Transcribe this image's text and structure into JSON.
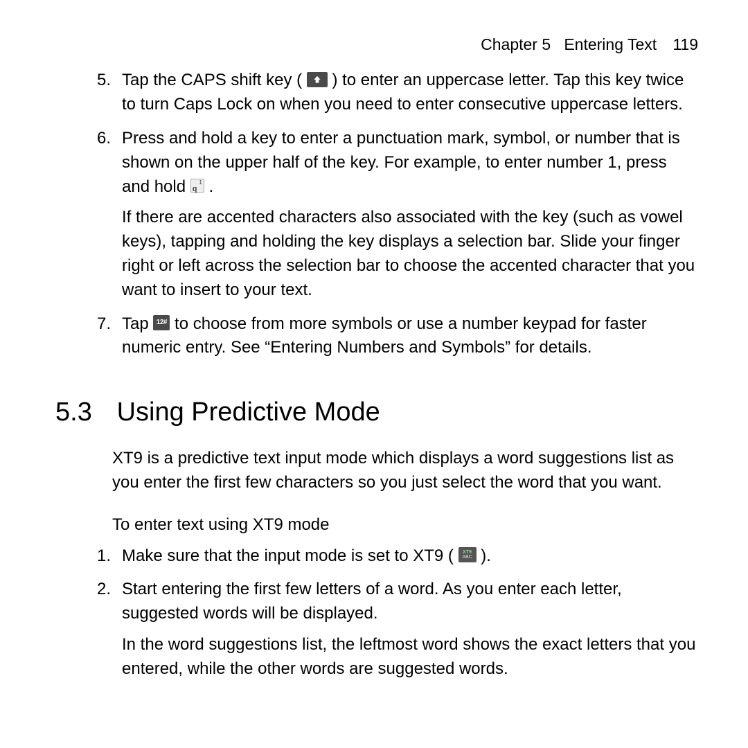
{
  "header": {
    "chapter_label": "Chapter 5",
    "chapter_title": "Entering Text",
    "page_number": "119"
  },
  "list_a": {
    "item5": {
      "text_before_icon": "Tap the CAPS shift key ( ",
      "text_after_icon": " ) to enter an uppercase letter. Tap this key twice to turn Caps Lock on when you need to enter consecutive uppercase letters."
    },
    "item6": {
      "para1_before": "Press and hold a key to enter a punctuation mark, symbol, or number that is shown on the upper half of the key. For example, to enter number 1, press and hold ",
      "para1_after": ".",
      "para2": "If there are accented characters also associated with the key (such as vowel keys), tapping and holding the key displays a selection bar. Slide your finger right or left across the selection bar to choose the accented character that you want to insert to your text."
    },
    "item7": {
      "text_before_icon": "Tap ",
      "text_after_icon": " to choose from more symbols or use a number keypad for faster numeric entry. See “Entering Numbers and Symbols” for details."
    }
  },
  "section": {
    "number": "5.3",
    "title": "Using Predictive Mode"
  },
  "intro": {
    "bold_lead": "XT9",
    "rest": " is a predictive text input mode which displays a word suggestions list as you enter the first few characters so you just select the word that you want."
  },
  "subheading": "To enter text using XT9 mode",
  "list_b": {
    "item1": {
      "text_before_icon": "Make sure that the input mode is set to XT9 ( ",
      "text_after_icon": " )."
    },
    "item2": {
      "para1": "Start entering the first few letters of a word. As you enter each letter, suggested words will be displayed.",
      "para2": "In the word suggestions list, the leftmost word shows the exact letters that you entered, while the other words are suggested words."
    }
  },
  "icons": {
    "shift": "shift-key-icon",
    "q_key": {
      "sup": "1",
      "main": "q"
    },
    "num_key": "12#",
    "xt9": {
      "top": "XT9",
      "bot": "ABC"
    }
  }
}
